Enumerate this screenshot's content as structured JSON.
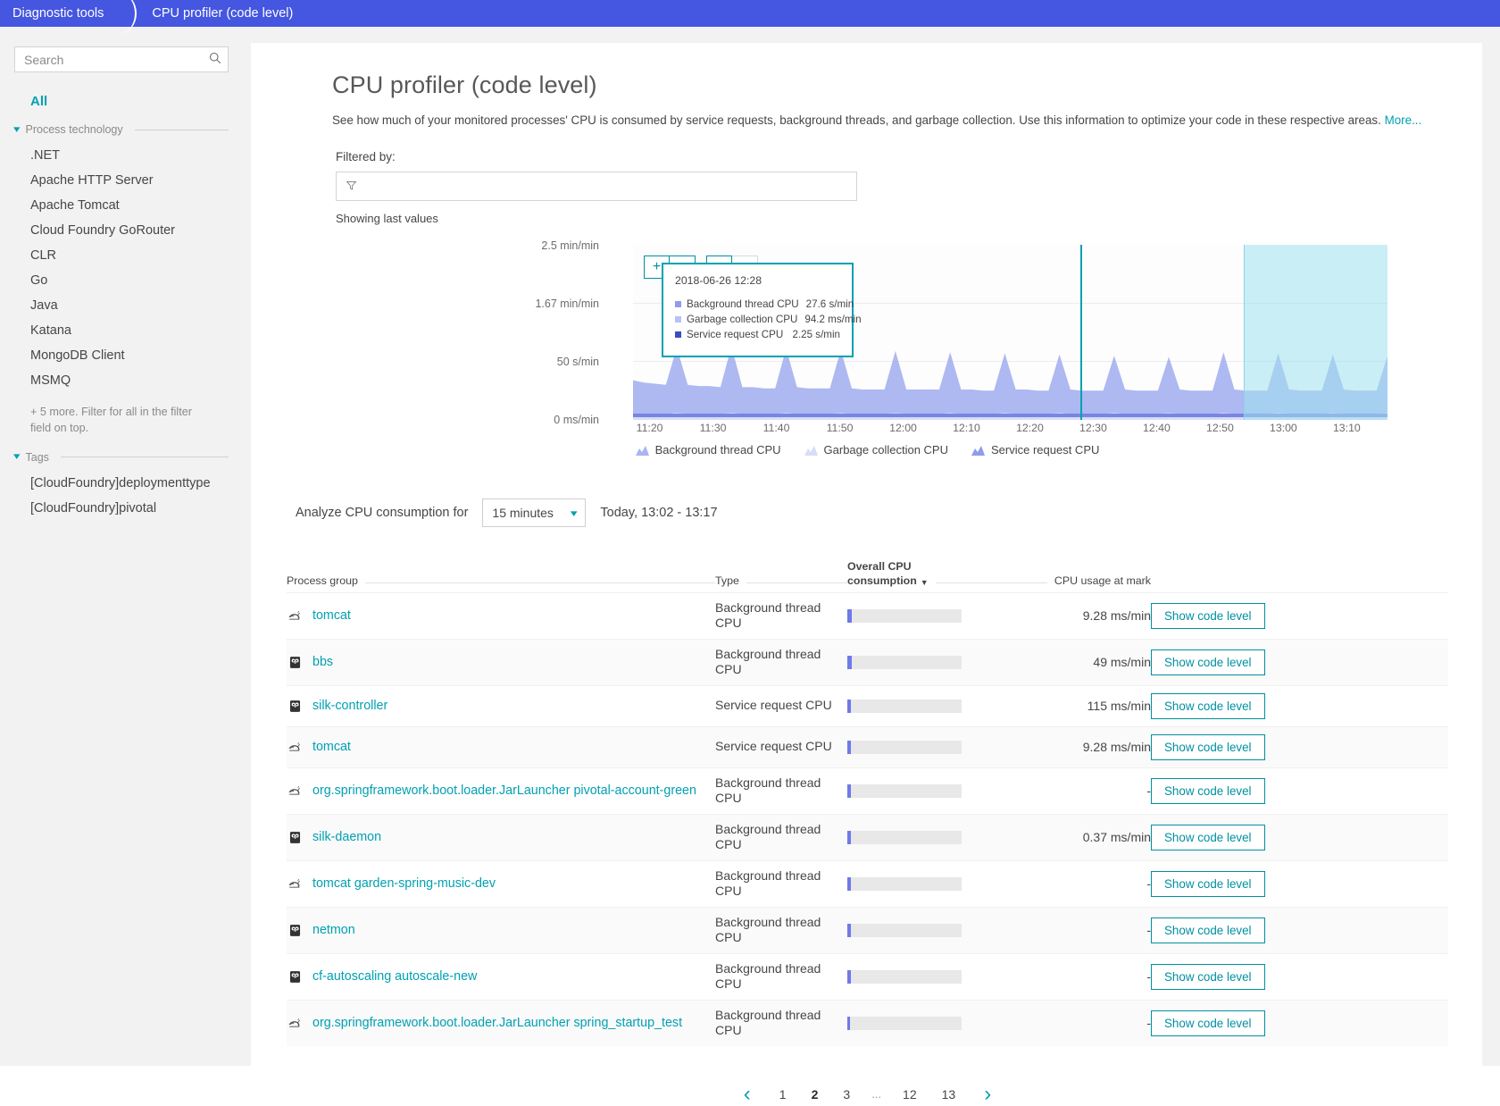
{
  "breadcrumb": {
    "root": "Diagnostic tools",
    "current": "CPU profiler (code level)"
  },
  "sidebar": {
    "search_placeholder": "Search",
    "all_label": "All",
    "groups": [
      {
        "title": "Process technology",
        "items": [
          ".NET",
          "Apache HTTP Server",
          "Apache Tomcat",
          "Cloud Foundry GoRouter",
          "CLR",
          "Go",
          "Java",
          "Katana",
          "MongoDB Client",
          "MSMQ"
        ],
        "note": "+ 5 more. Filter for all in the filter field on top."
      },
      {
        "title": "Tags",
        "items": [
          "[CloudFoundry]deploymenttype",
          "[CloudFoundry]pivotal"
        ],
        "note": ""
      }
    ]
  },
  "page": {
    "title": "CPU profiler (code level)",
    "description": "See how much of your monitored processes' CPU is consumed by service requests, background threads, and garbage collection. Use this information to optimize your code in these respective areas.",
    "more_link": "More...",
    "filtered_by_label": "Filtered by:",
    "filter_placeholder": "",
    "showing_text": "Showing last values"
  },
  "chart_controls": {
    "zoom_in": "+",
    "zoom_out": "−",
    "pan_left": "←",
    "pan_right": "→"
  },
  "tooltip": {
    "date": "2018-06-26 12:28",
    "rows": [
      {
        "label": "Background thread CPU",
        "value": "27.6 s/min",
        "color": "#8e9ceb"
      },
      {
        "label": "Garbage collection CPU",
        "value": "94.2 ms/min",
        "color": "#b9c2f2"
      },
      {
        "label": "Service request CPU",
        "value": "2.25 s/min",
        "color": "#3c4cc0"
      }
    ]
  },
  "chart_data": {
    "type": "area",
    "title": "",
    "xlabel": "",
    "ylabel": "",
    "ytick_labels": [
      "2.5 min/min",
      "1.67 min/min",
      "50 s/min",
      "0 ms/min"
    ],
    "ytick_positions": [
      0,
      33.3,
      66.6,
      100
    ],
    "xtick_labels": [
      "11:20",
      "11:30",
      "11:40",
      "11:50",
      "12:00",
      "12:10",
      "12:20",
      "12:30",
      "12:40",
      "12:50",
      "13:00",
      "13:10"
    ],
    "grid": true,
    "legend_position": "bottom",
    "legend": [
      "Background thread CPU",
      "Garbage collection CPU",
      "Service request CPU"
    ],
    "series": [
      {
        "name": "Background thread CPU",
        "color": "#aab4f0",
        "values": [
          34,
          32,
          31,
          30,
          62,
          30,
          29,
          29,
          28,
          63,
          28,
          28,
          27,
          27,
          61,
          28,
          27,
          27,
          27,
          60,
          27,
          26,
          26,
          26,
          59,
          26,
          26,
          26,
          26,
          58,
          26,
          26,
          25,
          25,
          57,
          26,
          26,
          25,
          25,
          56,
          26,
          25,
          25,
          25,
          55,
          26,
          25,
          25,
          25,
          54,
          26,
          25,
          25,
          25,
          58,
          26,
          25,
          25,
          25,
          57,
          26,
          25,
          25,
          25,
          56,
          26,
          25,
          25,
          25,
          55
        ]
      },
      {
        "name": "Garbage collection CPU",
        "color": "#d7ddf8",
        "values": [
          2,
          2,
          2,
          2,
          3,
          2,
          2,
          2,
          2,
          3,
          2,
          2,
          2,
          2,
          3,
          2,
          2,
          2,
          2,
          3,
          2,
          2,
          2,
          2,
          3,
          2,
          2,
          2,
          2,
          3,
          2,
          2,
          2,
          2,
          3,
          2,
          2,
          2,
          2,
          3,
          2,
          2,
          2,
          2,
          3,
          2,
          2,
          2,
          2,
          3,
          2,
          2,
          2,
          2,
          3,
          2,
          2,
          2,
          2,
          3,
          2,
          2,
          2,
          2,
          3,
          2,
          2,
          2,
          2,
          3
        ]
      },
      {
        "name": "Service request CPU",
        "color": "#5b68d8",
        "values": [
          1.5,
          1.5,
          1.5,
          1.5,
          2,
          1.5,
          1.5,
          1.5,
          1.5,
          2,
          1.5,
          1.5,
          1.5,
          1.5,
          2,
          1.5,
          1.5,
          1.5,
          1.5,
          2,
          1.5,
          1.5,
          1.5,
          1.5,
          2,
          1.5,
          1.5,
          1.5,
          1.5,
          2,
          1.5,
          1.5,
          1.5,
          1.5,
          2,
          1.5,
          1.5,
          1.5,
          1.5,
          2,
          1.5,
          1.5,
          1.5,
          1.5,
          2,
          1.5,
          1.5,
          1.5,
          1.5,
          2,
          1.5,
          1.5,
          1.5,
          1.5,
          2,
          1.5,
          1.5,
          1.5,
          1.5,
          2,
          1.5,
          1.5,
          1.5,
          1.5,
          2,
          1.5,
          1.5,
          1.5,
          1.5,
          2
        ]
      }
    ],
    "marker_time": "12:28",
    "selection_start": "13:02",
    "selection_end": "13:17"
  },
  "analyze": {
    "label": "Analyze CPU consumption for",
    "interval": "15 minutes",
    "range": "Today, 13:02 - 13:17"
  },
  "table": {
    "headers": {
      "process_group": "Process group",
      "type": "Type",
      "overall_line1": "Overall CPU",
      "overall_line2": "consumption",
      "sort_caret": "▼",
      "usage_at_mark": "CPU usage at mark"
    },
    "action_label": "Show code level",
    "rows": [
      {
        "icon": "tomcat-icon",
        "name": "tomcat",
        "type": "Background thread CPU",
        "bar_pct": 4,
        "mark": "9.28 ms/min"
      },
      {
        "icon": "go-gopher-icon",
        "name": "bbs",
        "type": "Background thread CPU",
        "bar_pct": 4,
        "mark": "49 ms/min"
      },
      {
        "icon": "go-gopher-icon",
        "name": "silk-controller",
        "type": "Service request CPU",
        "bar_pct": 3.5,
        "mark": "115 ms/min"
      },
      {
        "icon": "tomcat-icon",
        "name": "tomcat",
        "type": "Service request CPU",
        "bar_pct": 3.5,
        "mark": "9.28 ms/min"
      },
      {
        "icon": "tomcat-icon",
        "name": "org.springframework.boot.loader.JarLauncher pivotal-account-green",
        "type": "Background thread CPU",
        "bar_pct": 3,
        "mark": "-"
      },
      {
        "icon": "go-gopher-icon",
        "name": "silk-daemon",
        "type": "Background thread CPU",
        "bar_pct": 3,
        "mark": "0.37 ms/min"
      },
      {
        "icon": "tomcat-icon",
        "name": "tomcat garden-spring-music-dev",
        "type": "Background thread CPU",
        "bar_pct": 3,
        "mark": "-"
      },
      {
        "icon": "go-gopher-icon",
        "name": "netmon",
        "type": "Background thread CPU",
        "bar_pct": 3,
        "mark": "-"
      },
      {
        "icon": "go-gopher-icon",
        "name": "cf-autoscaling autoscale-new",
        "type": "Background thread CPU",
        "bar_pct": 3,
        "mark": "-"
      },
      {
        "icon": "tomcat-icon",
        "name": "org.springframework.boot.loader.JarLauncher spring_startup_test",
        "type": "Background thread CPU",
        "bar_pct": 2.5,
        "mark": "-"
      }
    ]
  },
  "pagination": {
    "prev": "‹",
    "next": "›",
    "pages": [
      "1",
      "2",
      "3",
      "...",
      "12",
      "13"
    ],
    "active": "2"
  },
  "colors": {
    "accent": "#00a1b2",
    "breadcrumb_bg": "#4556e0",
    "link": "#00a1b2",
    "series_background": "#aab4f0",
    "series_gc": "#d7ddf8",
    "series_request": "#5b68d8"
  }
}
